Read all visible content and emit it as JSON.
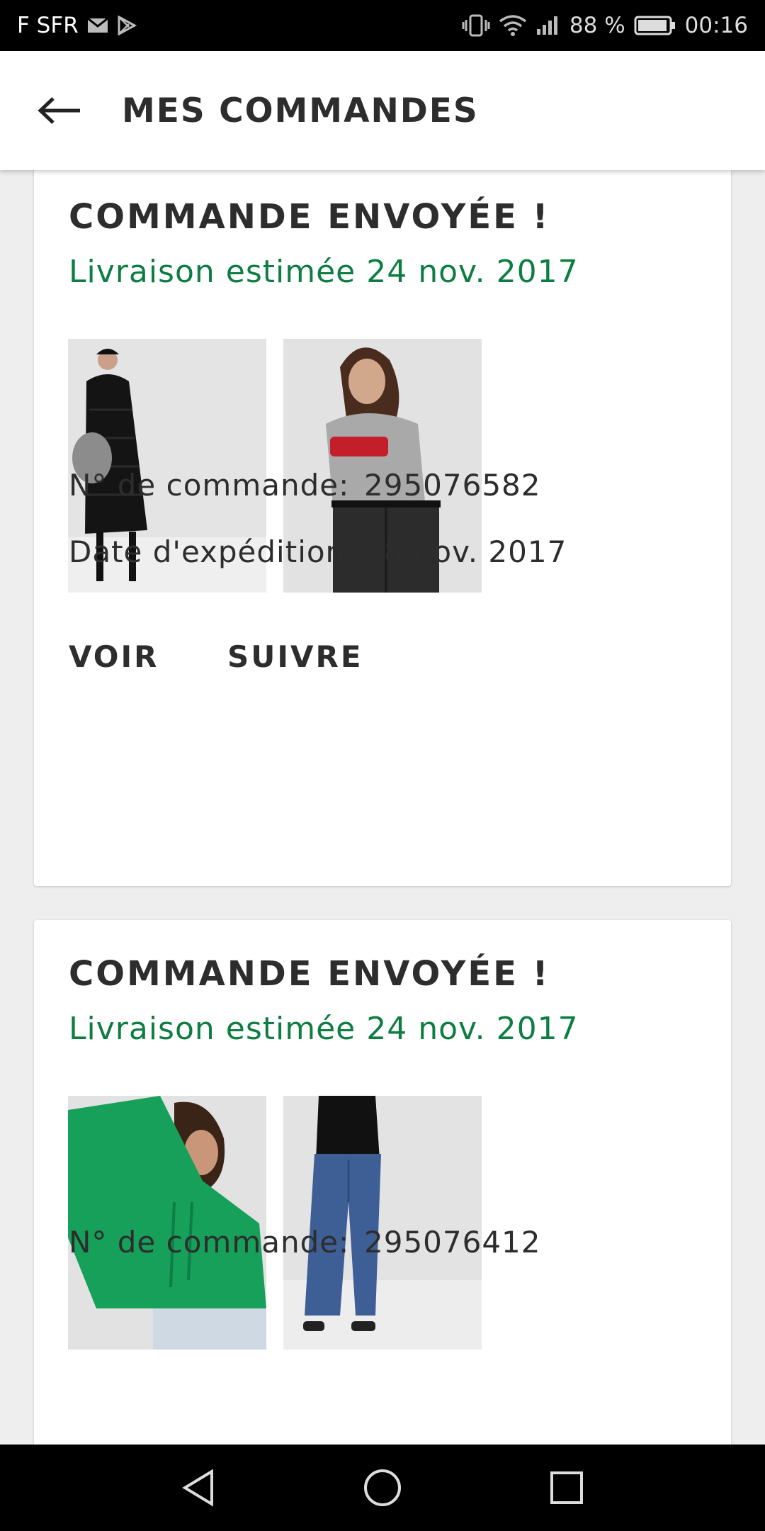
{
  "status_bar": {
    "carrier": "F SFR",
    "battery_pct": "88 %",
    "time": "00:16",
    "icons": [
      "mail-icon",
      "play-store-icon",
      "vibrate-icon",
      "wifi-icon",
      "signal-icon",
      "battery-icon"
    ]
  },
  "header": {
    "back_icon": "arrow-left-icon",
    "title": "MES COMMANDES"
  },
  "orders": [
    {
      "status": "COMMANDE ENVOYÉE !",
      "delivery": "Livraison estimée 24 nov. 2017",
      "items": [
        "black puffer coat product image",
        "grey Levi's t-shirt product image"
      ],
      "order_label": "N° de commande:",
      "order_number": "295076582",
      "ship_label": "Date d'expédition:",
      "ship_date": "18 nov. 2017",
      "actions": {
        "view": "VOIR",
        "track": "SUIVRE"
      }
    },
    {
      "status": "COMMANDE ENVOYÉE !",
      "delivery": "Livraison estimée 24 nov. 2017",
      "items": [
        "green hoodie product image",
        "wide leg jeans product image"
      ],
      "order_label": "N° de commande:",
      "order_number": "295076412"
    }
  ],
  "nav_bar": {
    "icons": [
      "back-triangle-icon",
      "home-circle-icon",
      "recents-square-icon"
    ]
  },
  "colors": {
    "accent_green": "#0e7d42",
    "text_dark": "#2d2d2d",
    "background": "#eeeeee"
  }
}
